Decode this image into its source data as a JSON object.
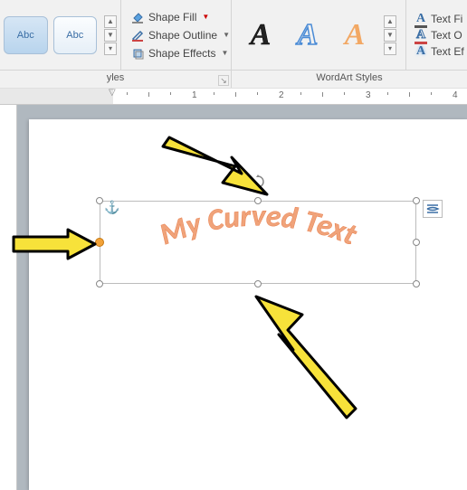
{
  "ribbon": {
    "shape_gallery": {
      "items": [
        "Abc",
        "Abc"
      ]
    },
    "shape_menu": {
      "fill": "Shape Fill",
      "outline": "Shape Outline",
      "effects": "Shape Effects"
    },
    "wordart_gallery": {
      "sample": "A"
    },
    "text_menu": {
      "fill": "Text Fi",
      "outline": "Text O",
      "effects": "Text Ef"
    },
    "groups": {
      "shape_styles": "yles",
      "wordart_styles": "WordArt Styles"
    }
  },
  "ruler": {
    "ticks": [
      "1",
      "2",
      "3",
      "4"
    ]
  },
  "document": {
    "wordart_text": "My Curved Text"
  }
}
